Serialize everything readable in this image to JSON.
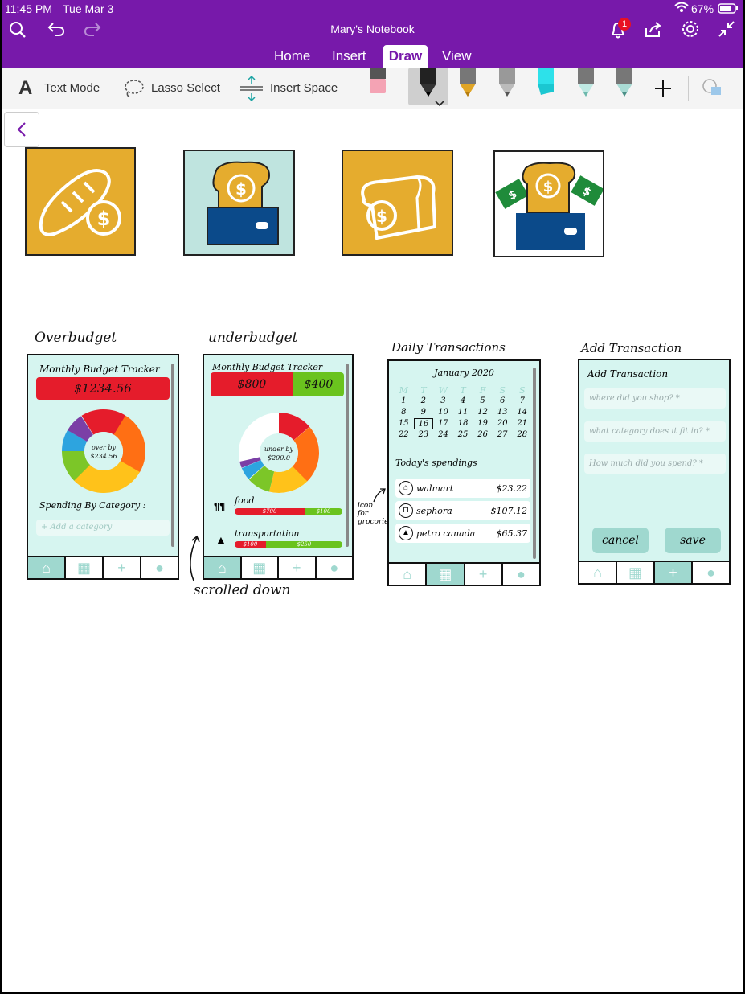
{
  "status": {
    "time": "11:45 PM",
    "date": "Tue Mar 3",
    "battery": "67%",
    "notifications": "1"
  },
  "app": {
    "title": "Mary's Notebook",
    "tabs": [
      "Home",
      "Insert",
      "Draw",
      "View"
    ],
    "active_tab": "Draw"
  },
  "toolbar": {
    "text_mode": "Text Mode",
    "lasso": "Lasso Select",
    "insert_space": "Insert Space"
  },
  "colors": {
    "accent": "#7719aa",
    "mustard": "#e5ac2e",
    "mint": "#d6f5f0",
    "teal": "#9fd8cf",
    "red": "#e51c2b",
    "green": "#6ac31e",
    "navy": "#0b4a8a"
  },
  "sketch": {
    "over": {
      "heading": "Overbudget",
      "title": "Monthly Budget Tracker",
      "amount": "$1234.56",
      "donut_text": [
        "over by",
        "$234.56"
      ],
      "spending_label": "Spending By Category :",
      "add_category": "+ Add a category"
    },
    "under": {
      "heading": "underbudget",
      "title": "Monthly Budget Tracker",
      "spent": "$800",
      "left": "$400",
      "donut_text": [
        "under by",
        "$200.0"
      ],
      "categories": [
        {
          "name": "food",
          "spent": "$700",
          "left": "$100"
        },
        {
          "name": "transportation",
          "spent": "$100",
          "left": "$250"
        }
      ],
      "note": "scrolled down"
    },
    "daily": {
      "heading": "Daily Transactions",
      "month": "January 2020",
      "weekdays": [
        "M",
        "T",
        "W",
        "T",
        "F",
        "S",
        "S"
      ],
      "weeks": [
        [
          "1",
          "2",
          "3",
          "4",
          "5",
          "6",
          "7"
        ],
        [
          "8",
          "9",
          "10",
          "11",
          "12",
          "13",
          "14"
        ],
        [
          "15",
          "16",
          "17",
          "18",
          "19",
          "20",
          "21"
        ],
        [
          "22",
          "23",
          "24",
          "25",
          "26",
          "27",
          "28"
        ]
      ],
      "selected_day": "16",
      "spendings_title": "Today's spendings",
      "transactions": [
        {
          "store": "walmart",
          "amount": "$23.22"
        },
        {
          "store": "sephora",
          "amount": "$107.12"
        },
        {
          "store": "petro canada",
          "amount": "$65.37"
        }
      ],
      "icon_note": [
        "icon",
        "for",
        "grocories"
      ]
    },
    "add": {
      "heading": "Add Transaction",
      "title": "Add Transaction",
      "fields": [
        "where did you shop? *",
        "what category does it fit in? *",
        "How much did you spend? *"
      ],
      "cancel": "cancel",
      "save": "save"
    }
  }
}
